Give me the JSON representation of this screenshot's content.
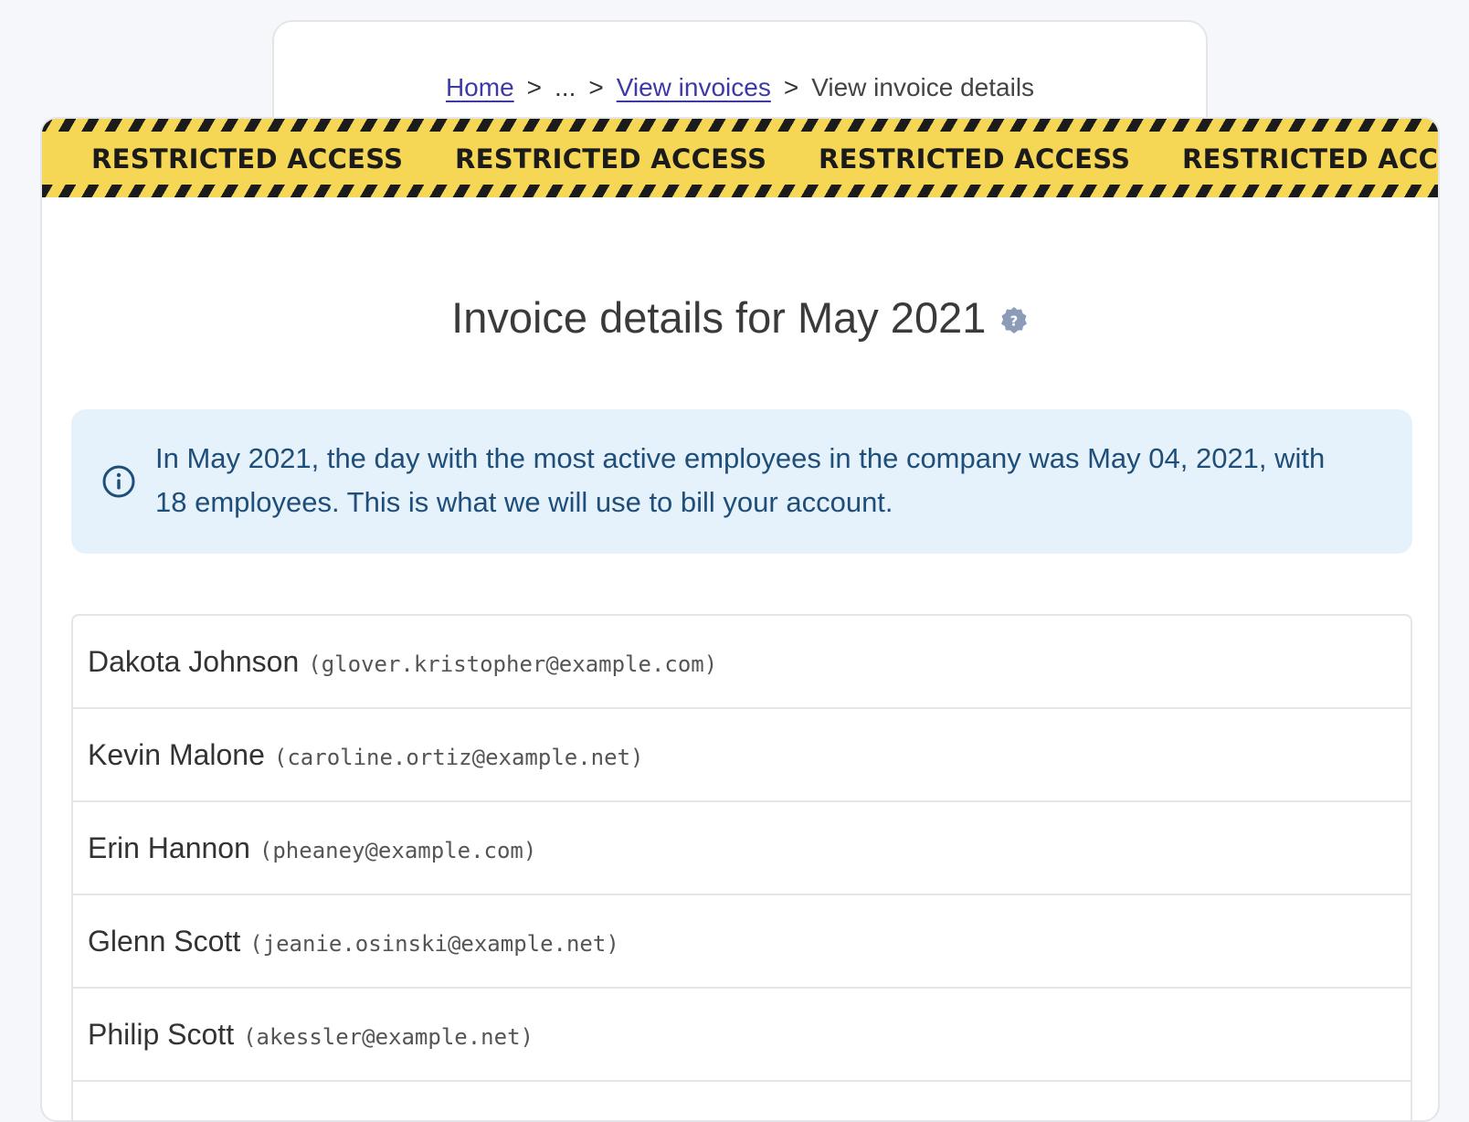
{
  "breadcrumb": {
    "home": "Home",
    "separator": ">",
    "ellipsis": "...",
    "view_invoices": "View invoices",
    "current": "View invoice details"
  },
  "banner": {
    "text": "RESTRICTED ACCESS",
    "colors": {
      "tape": "#f5d655",
      "stripe": "#1b1b1b"
    }
  },
  "page": {
    "title": "Invoice details for May 2021",
    "help_icon": "question-badge-icon"
  },
  "alert": {
    "icon": "info-icon",
    "message": "In May 2021, the day with the most active employees in the company was May 04, 2021, with 18 employees. This is what we will use to bill your account."
  },
  "employees": [
    {
      "name": "Dakota Johnson",
      "email": "(glover.kristopher@example.com)"
    },
    {
      "name": "Kevin Malone",
      "email": "(caroline.ortiz@example.net)"
    },
    {
      "name": "Erin Hannon",
      "email": "(pheaney@example.com)"
    },
    {
      "name": "Glenn Scott",
      "email": "(jeanie.osinski@example.net)"
    },
    {
      "name": "Philip Scott",
      "email": "(akessler@example.net)"
    }
  ]
}
